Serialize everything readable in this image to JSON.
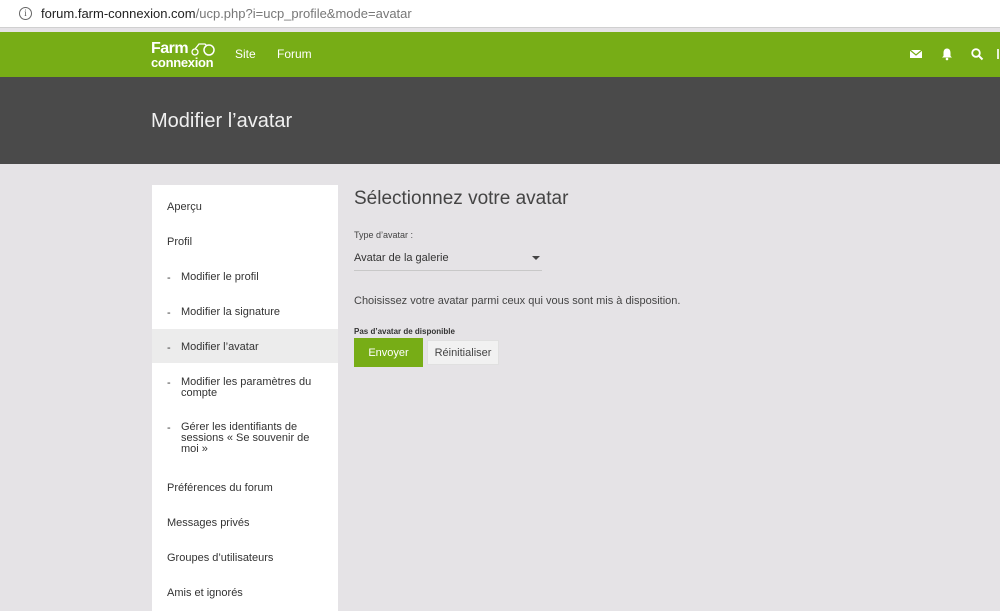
{
  "browser": {
    "url_domain": "forum.farm-connexion.com",
    "url_path": "/ucp.php?i=ucp_profile&mode=avatar"
  },
  "nav": {
    "logo_line1": "Farm",
    "logo_line2": "connexion",
    "links": [
      "Site",
      "Forum"
    ],
    "icons": [
      "envelope-icon",
      "bell-icon",
      "search-icon"
    ],
    "color": "#77ad16"
  },
  "header": {
    "title": "Modifier l’avatar",
    "color": "#4a4a4a"
  },
  "sidebar": {
    "items": [
      {
        "label": "Aperçu",
        "level": "top"
      },
      {
        "label": "Profil",
        "level": "top"
      },
      {
        "label": "Modifier le profil",
        "level": "sub"
      },
      {
        "label": "Modifier la signature",
        "level": "sub"
      },
      {
        "label": "Modifier l’avatar",
        "level": "sub",
        "active": true
      },
      {
        "label": "Modifier les paramètres du compte",
        "level": "sub"
      },
      {
        "label": "Gérer les identifiants de sessions « Se souvenir de moi »",
        "level": "sub"
      },
      {
        "label": "Préférences du forum",
        "level": "top"
      },
      {
        "label": "Messages privés",
        "level": "top"
      },
      {
        "label": "Groupes d’utilisateurs",
        "level": "top"
      },
      {
        "label": "Amis et ignorés",
        "level": "top"
      }
    ],
    "dash": "-"
  },
  "main": {
    "title": "Sélectionnez votre avatar",
    "type_label": "Type d’avatar :",
    "type_value": "Avatar de la galerie",
    "choose_text": "Choisissez votre avatar parmi ceux qui vous sont mis à disposition.",
    "no_avatar": "Pas d’avatar de disponible",
    "submit_label": "Envoyer",
    "reset_label": "Réinitialiser"
  }
}
